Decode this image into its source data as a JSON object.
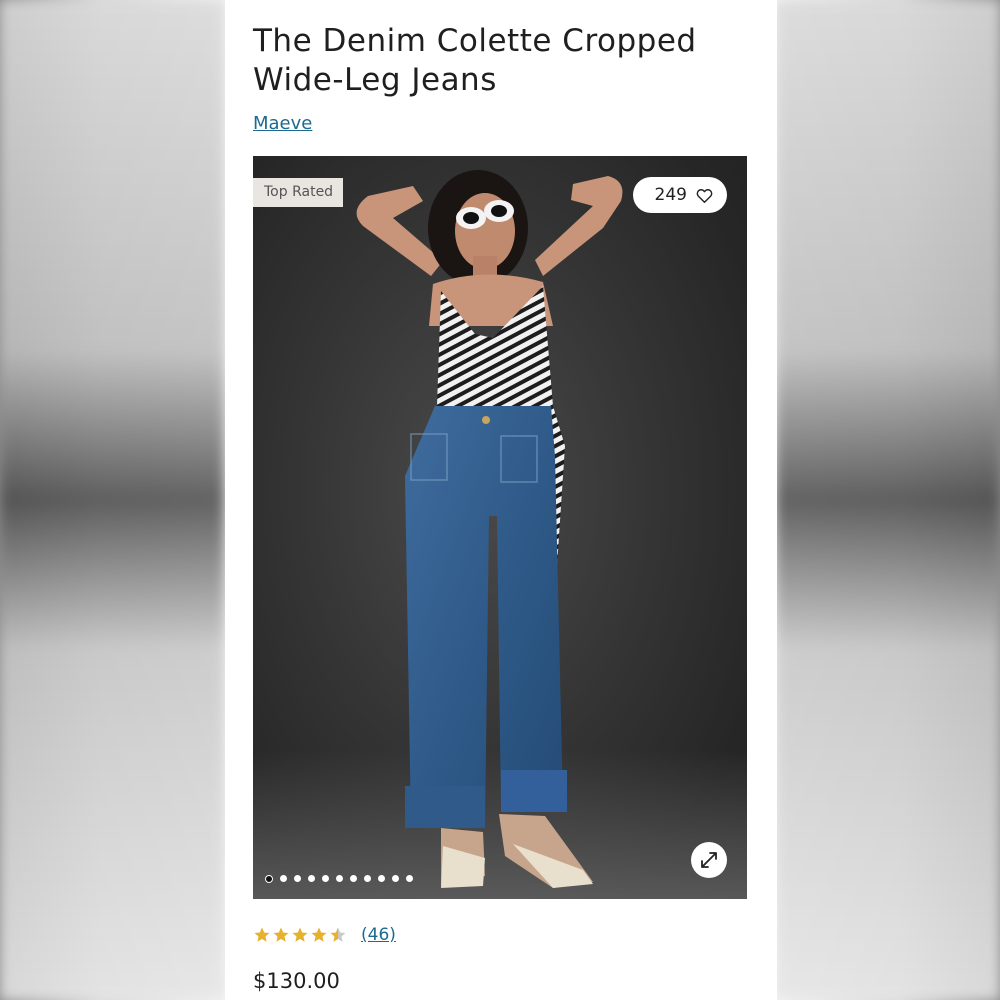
{
  "product": {
    "title": "The Denim Colette Cropped Wide-Leg Jeans",
    "brand": "Maeve",
    "badge": "Top Rated",
    "favorites_count": "249",
    "rating": 4.5,
    "reviews_label": "(46)",
    "price": "$130.00"
  },
  "gallery": {
    "total_images": 11,
    "current_index": 1
  },
  "icons": {
    "favorite": "heart-outline-icon",
    "zoom": "expand-arrows-icon",
    "star": "star-icon"
  },
  "colors": {
    "link": "#1c6a8f",
    "star": "#e5b12e",
    "text": "#1f1f1f",
    "badge_bg": "#e9e6e1"
  }
}
